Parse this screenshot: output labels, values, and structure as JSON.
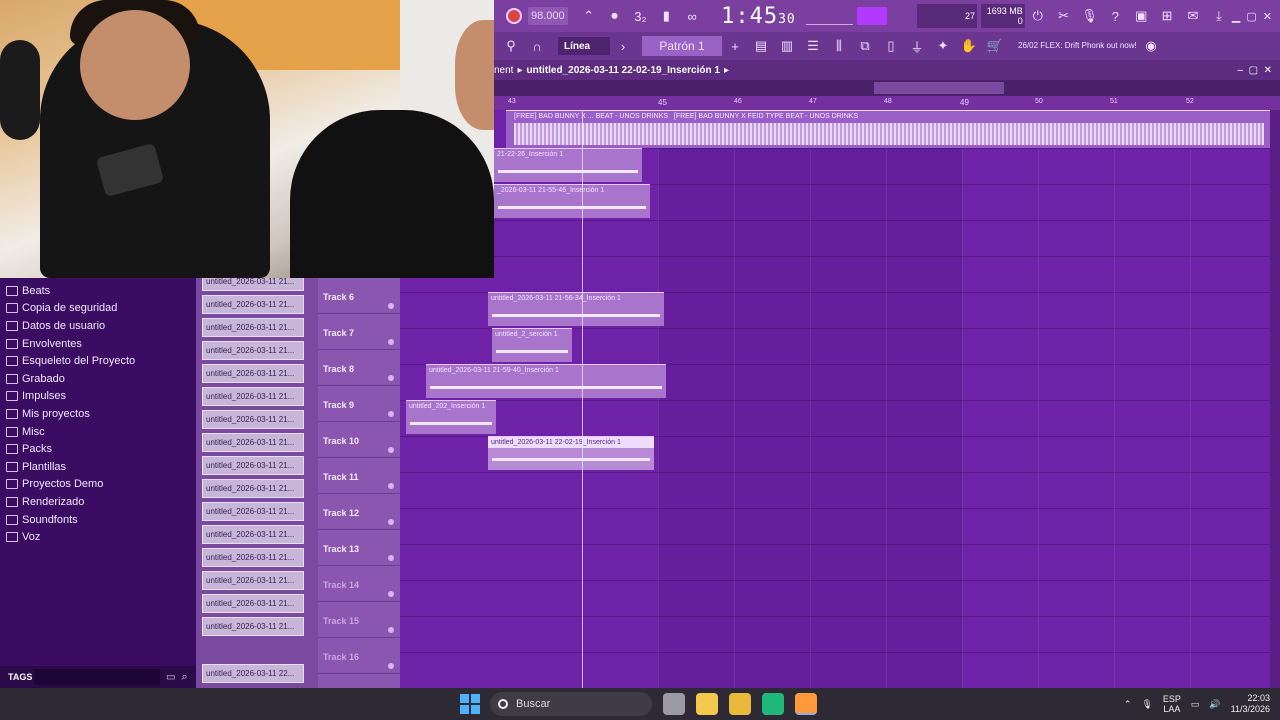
{
  "toolbar": {
    "bpm": "98.000",
    "time_main": "1:45",
    "time_sub": "30",
    "time_unit": "M:S:CS",
    "cpu_value": "27",
    "mem_value": "1693 MB",
    "mem_sub": "0",
    "mode": "Línea",
    "pattern": "Patrón 1",
    "news_date": "26/02",
    "news_text": "FLEX: Drift Phonk out now!"
  },
  "titlebar": {
    "prefix": "nent",
    "crumb": "untitled_2026-03-11 22-02-19_Inserción 1"
  },
  "ruler": [
    "43",
    "45",
    "46",
    "47",
    "48",
    "49",
    "50",
    "51",
    "52"
  ],
  "browser": {
    "items": [
      "Beats",
      "Copia de seguridad",
      "Datos de usuario",
      "Envolventes",
      "Esqueleto del Proyecto",
      "Grabado",
      "Impulses",
      "Mis proyectos",
      "Misc",
      "Packs",
      "Plantillas",
      "Proyectos Demo",
      "Renderizado",
      "Soundfonts",
      "Voz"
    ],
    "tags_label": "TAGS"
  },
  "picker": {
    "items": [
      "untitled_2026-03-11 21...",
      "untitled_2026-03-11 21...",
      "untitled_2026-03-11 21...",
      "untitled_2026-03-11 21...",
      "untitled_2026-03-11 21...",
      "untitled_2026-03-11 21...",
      "untitled_2026-03-11 21...",
      "untitled_2026-03-11 21...",
      "untitled_2026-03-11 21...",
      "untitled_2026-03-11 21...",
      "untitled_2026-03-11 21...",
      "untitled_2026-03-11 21...",
      "untitled_2026-03-11 21...",
      "untitled_2026-03-11 21...",
      "untitled_2026-03-11 21...",
      "untitled_2026-03-11 21...",
      "untitled_2026-03-11 22..."
    ]
  },
  "tracks": [
    "Track 6",
    "Track 7",
    "Track 8",
    "Track 9",
    "Track 10",
    "Track 11",
    "Track 12",
    "Track 13",
    "Track 14",
    "Track 15",
    "Track 16"
  ],
  "clips": {
    "audio_main": "[FREE] BAD BUNNY X FEID TYPE BEAT - UNOS DRINKS",
    "audio_main_prefix": "[FREE] BAD BUNNY X",
    "audio_main_suffix": "BEAT - UNOS DRINKS",
    "c1": "21-22-26_Inserción 1",
    "c2": "_2026-03-11 21-55-46_Inserción 1",
    "c6": "untitled_2026-03-11 21-56-34_Inserción 1",
    "c7": "untitled_2_serción 1",
    "c8": "untitled_2026-03-11 21-59-40_Inserción 1",
    "c9": "untitled_202_Inserción 1",
    "c10": "untitled_2026-03-11 22-02-19_Inserción 1"
  },
  "taskbar": {
    "search_placeholder": "Buscar",
    "lang_top": "ESP",
    "lang_bottom": "LAA",
    "time": "22:03",
    "date": "11/3/2026"
  }
}
